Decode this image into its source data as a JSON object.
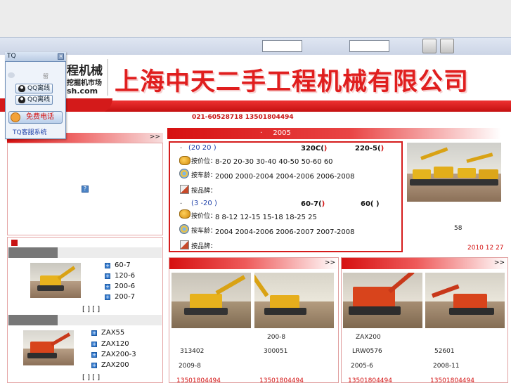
{
  "header": {
    "logo_line1": "程机械",
    "logo_line2": "挖掘机市场",
    "logo_line3": "sh.com",
    "banner_title": "上海中天二手工程机械有限公司",
    "phone_line": "021-60528718 13501804494"
  },
  "tq_widget": {
    "title": "TQ",
    "qq1": "QQ离线",
    "qq2": "QQ离线",
    "side_label": "留",
    "call_label": "免费电话",
    "footer": "TQ客服系统"
  },
  "left_panel": {
    "more": ">>",
    "pager1": "[ ] [ ]",
    "pager2": "[ ] [ ]",
    "group1_models": [
      "60-7",
      "120-6",
      "200-6",
      "200-7"
    ],
    "group2_models": [
      "ZAX55",
      "ZAX120",
      "ZAX200-3",
      "ZAX200"
    ]
  },
  "center": {
    "tab_dot": "·",
    "tab_year": "2005",
    "block1": {
      "range": "(20  20   )",
      "model_a": "320C(",
      "model_a_close": ")",
      "model_b": "220-5(",
      "model_b_close": ")",
      "price_label": "按价位：",
      "prices": "8-20  20-30  30-40  40-50  50-60  60",
      "age_label": "按车龄：",
      "ages": "2000    2000-2004  2004-2006  2006-2008",
      "brand_label": "按品牌："
    },
    "block2": {
      "range": "(3 -20 )",
      "model_a": "60-7(",
      "model_a_close": ")",
      "model_b": "60(  )",
      "price_label": "按价位：",
      "prices": "8    8-12  12-15  15-18  18-25  25",
      "age_label": "按车龄：",
      "ages": "2004    2004-2006  2006-2007  2007-2008",
      "brand_label": "按品牌："
    },
    "side_count": "58",
    "side_date": "2010 12 27"
  },
  "bottom_left": {
    "more": ">>",
    "items": [
      {
        "code": "313402",
        "date": "2009-8",
        "phone": "13501804494"
      },
      {
        "code": "200-8",
        "serial": "300051",
        "phone": "13501804494"
      }
    ]
  },
  "bottom_right": {
    "more": ">>",
    "items": [
      {
        "model": "ZAX200",
        "code": "LRW0576",
        "date": "2005-6",
        "phone": "13501804494"
      },
      {
        "code": "52601",
        "date": "2008-11",
        "phone": "13501804494"
      }
    ]
  }
}
